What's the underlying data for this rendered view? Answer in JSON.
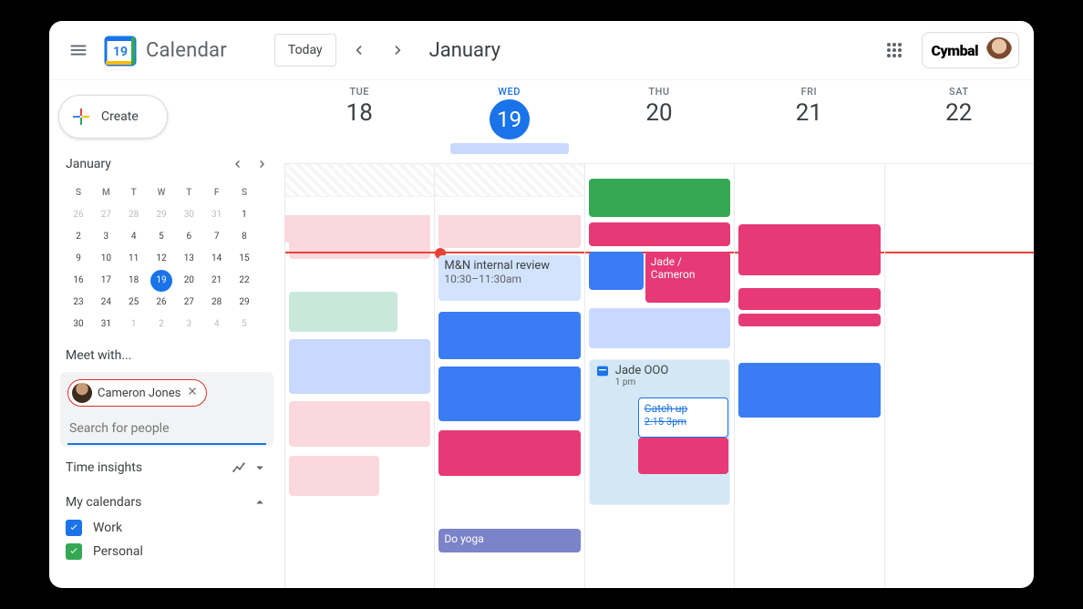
{
  "header": {
    "app_title": "Calendar",
    "logo_day": "19",
    "today_label": "Today",
    "month_label": "January",
    "org_name": "Cymbal"
  },
  "sidebar": {
    "create_label": "Create",
    "mini": {
      "title": "January",
      "dow": [
        "S",
        "M",
        "T",
        "W",
        "T",
        "F",
        "S"
      ],
      "cells": [
        {
          "n": "26",
          "dim": true
        },
        {
          "n": "27",
          "dim": true
        },
        {
          "n": "28",
          "dim": true
        },
        {
          "n": "29",
          "dim": true
        },
        {
          "n": "30",
          "dim": true
        },
        {
          "n": "31",
          "dim": true
        },
        {
          "n": "1"
        },
        {
          "n": "2"
        },
        {
          "n": "3"
        },
        {
          "n": "4"
        },
        {
          "n": "5"
        },
        {
          "n": "6"
        },
        {
          "n": "7"
        },
        {
          "n": "8"
        },
        {
          "n": "9"
        },
        {
          "n": "10"
        },
        {
          "n": "11"
        },
        {
          "n": "12"
        },
        {
          "n": "13"
        },
        {
          "n": "14"
        },
        {
          "n": "15"
        },
        {
          "n": "16"
        },
        {
          "n": "17"
        },
        {
          "n": "18"
        },
        {
          "n": "19",
          "today": true
        },
        {
          "n": "20"
        },
        {
          "n": "21"
        },
        {
          "n": "22"
        },
        {
          "n": "23"
        },
        {
          "n": "24"
        },
        {
          "n": "25"
        },
        {
          "n": "26"
        },
        {
          "n": "27"
        },
        {
          "n": "28"
        },
        {
          "n": "29"
        },
        {
          "n": "30"
        },
        {
          "n": "31"
        },
        {
          "n": "1",
          "dim": true
        },
        {
          "n": "2",
          "dim": true
        },
        {
          "n": "3",
          "dim": true
        },
        {
          "n": "4",
          "dim": true
        },
        {
          "n": "5",
          "dim": true
        }
      ]
    },
    "meet_label": "Meet with...",
    "chip_name": "Cameron Jones",
    "search_placeholder": "Search for people",
    "time_insights_label": "Time insights",
    "my_cal_label": "My calendars",
    "cal1": "Work",
    "cal2": "Personal"
  },
  "days": [
    {
      "dow": "TUE",
      "num": "18"
    },
    {
      "dow": "WED",
      "num": "19",
      "active": true
    },
    {
      "dow": "THU",
      "num": "20"
    },
    {
      "dow": "FRI",
      "num": "21"
    },
    {
      "dow": "SAT",
      "num": "22"
    }
  ],
  "events": {
    "review_title": "M&N internal review",
    "review_time": "10:30–11:30am",
    "jade_cameron": "Jade / Cameron",
    "jade_ooo": "Jade OOO",
    "jade_ooo_time": "1 pm",
    "catchup": "Catch up",
    "catchup_time": "2:15-3pm",
    "yoga": "Do yoga"
  }
}
